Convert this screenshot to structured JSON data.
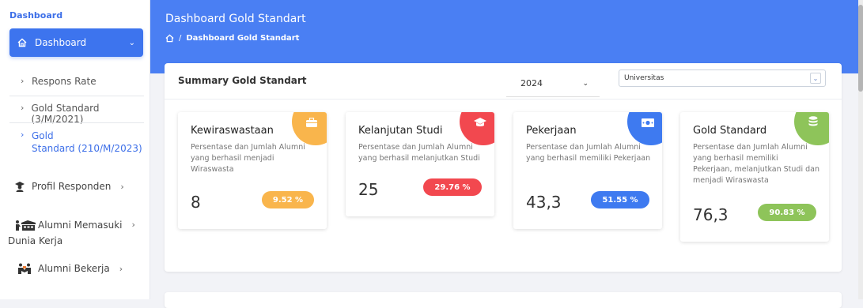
{
  "sidebar": {
    "title": "Dashboard",
    "active": {
      "label": "Dashboard",
      "icon": "home-icon",
      "chevron": "⌄"
    },
    "sub_items": [
      {
        "label": "Respons Rate",
        "arrow": "›"
      },
      {
        "label": "Gold Standard (3/M/2021)",
        "arrow": "›"
      },
      {
        "label_line1": "Gold",
        "label_line2": "Standard (210/M/2023)",
        "arrow": "›"
      }
    ],
    "items": [
      {
        "label": "Profil Responden",
        "icon": "graduate-icon",
        "chevron": "›"
      },
      {
        "label_line1": "Alumni Memasuki",
        "label_line2": "Dunia Kerja",
        "icon": "office-worker-icon",
        "chevron": "›"
      },
      {
        "label": "Alumni Bekerja",
        "icon": "handshake-icon",
        "chevron": "›"
      }
    ]
  },
  "header": {
    "title": "Dashboard Gold Standart",
    "breadcrumb_sep": "/",
    "breadcrumb_current": "Dashboard Gold Standart"
  },
  "summary": {
    "title": "Summary Gold Standart",
    "year_select": {
      "value": "2024",
      "chevron": "⌄"
    },
    "scope_select": {
      "value": "Universitas",
      "chevron": "⌄"
    }
  },
  "cards": [
    {
      "title": "Kewiraswastaan",
      "desc": "Persentase dan Jumlah Alumni yang berhasil menjadi Wiraswasta",
      "value": "8",
      "percent": "9.52 %",
      "icon": "briefcase-icon",
      "color": "#f9b54c"
    },
    {
      "title": "Kelanjutan Studi",
      "desc": "Persentase dan Jumlah Alumni yang berhasil melanjutkan Studi",
      "value": "25",
      "percent": "29.76 %",
      "icon": "graduation-cap-icon",
      "color": "#f2484f"
    },
    {
      "title": "Pekerjaan",
      "desc": "Persentase dan Jumlah Alumni yang berhasil memiliki Pekerjaan",
      "value": "43,3",
      "percent": "51.55 %",
      "icon": "money-icon",
      "color": "#3e7af0"
    },
    {
      "title": "Gold Standard",
      "desc": "Persentase dan Jumlah Alumni yang berhasil memiliki Pekerjaan, melanjutkan Studi dan menjadi Wiraswasta",
      "value": "76,3",
      "percent": "90.83 %",
      "icon": "coins-icon",
      "color": "#8ec45a"
    }
  ]
}
